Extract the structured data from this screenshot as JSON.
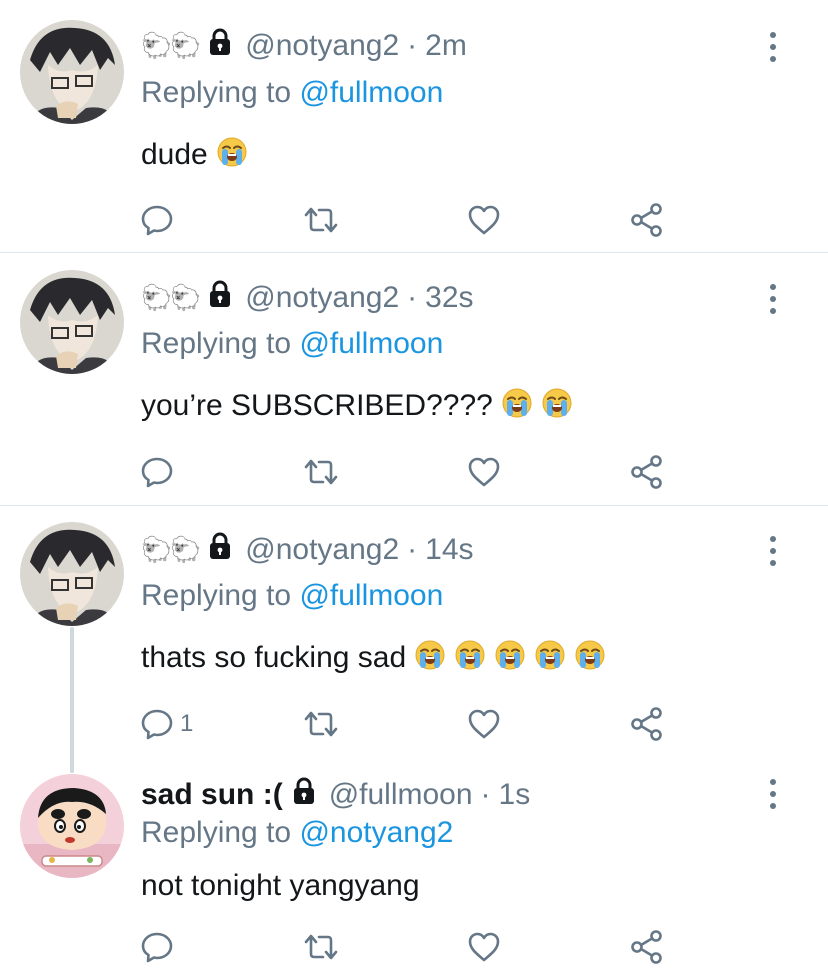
{
  "tweets": [
    {
      "display_name": "",
      "name_emoji": "🐑🐑",
      "handle": "@notyang2",
      "time": "2m",
      "replying_prefix": "Replying to",
      "replying_to": "@fullmoon",
      "text": "dude",
      "emoji_count": 1,
      "reply_count": "",
      "avatar": "anime-boy-glasses"
    },
    {
      "display_name": "",
      "name_emoji": "🐑🐑",
      "handle": "@notyang2",
      "time": "32s",
      "replying_prefix": "Replying to",
      "replying_to": "@fullmoon",
      "text": "you’re SUBSCRIBED????",
      "emoji_count": 2,
      "reply_count": "",
      "avatar": "anime-boy-glasses"
    },
    {
      "display_name": "",
      "name_emoji": "🐑🐑",
      "handle": "@notyang2",
      "time": "14s",
      "replying_prefix": "Replying to",
      "replying_to": "@fullmoon",
      "text": "thats so fucking sad",
      "emoji_count": 5,
      "reply_count": "1",
      "avatar": "anime-boy-glasses"
    },
    {
      "display_name": "sad sun :(",
      "name_emoji": "",
      "handle": "@fullmoon",
      "time": "1s",
      "replying_prefix": "Replying to",
      "replying_to": "@notyang2",
      "text": "not tonight yangyang",
      "emoji_count": 0,
      "reply_count": "",
      "avatar": "cartoon-boy"
    }
  ],
  "colors": {
    "link": "#1b95e0",
    "muted": "#657786",
    "text": "#14171a",
    "divider": "#e1e8ed"
  },
  "icons": [
    "lock-icon",
    "more-vertical-icon",
    "reply-icon",
    "retweet-icon",
    "like-icon",
    "share-icon",
    "loudly-crying-face-emoji"
  ],
  "separator": "·"
}
